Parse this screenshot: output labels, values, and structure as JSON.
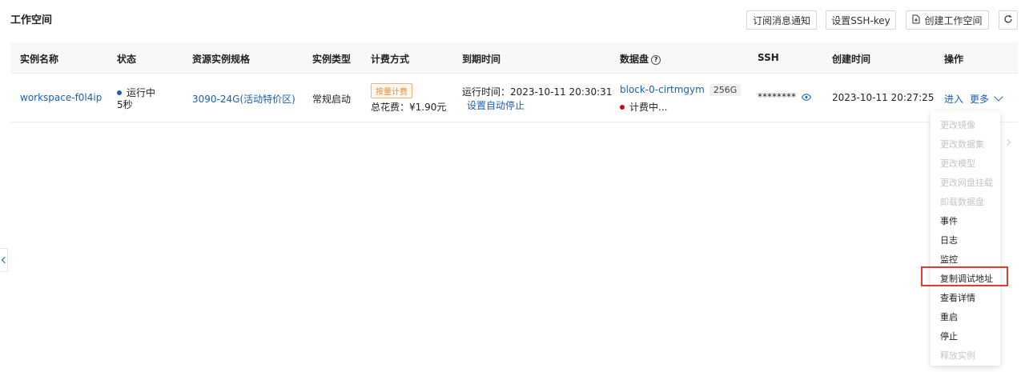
{
  "header": {
    "title": "工作空间",
    "subscribe_label": "订阅消息通知",
    "ssh_key_label": "设置SSH-key",
    "create_label": "创建工作空间"
  },
  "table": {
    "columns": [
      "实例名称",
      "状态",
      "资源实例规格",
      "实例类型",
      "计费方式",
      "到期时间",
      "数据盘",
      "SSH",
      "创建时间",
      "操作"
    ],
    "row": {
      "name": "workspace-f0l4ip",
      "status": "运行中",
      "status_duration": "5秒",
      "spec": "3090-24G(活动特价区)",
      "instance_type": "常规启动",
      "billing_tag": "按量计费",
      "total_cost": "总花费：¥1.90元",
      "expire_time": "运行时间：2023-10-11 20:30:31",
      "auto_stop": "设置自动停止",
      "disk_name": "block-0-cirtmgym",
      "disk_size": "256G",
      "disk_status": "计费中...",
      "ssh": "********",
      "created": "2023-10-11 20:27:25",
      "enter": "进入",
      "more": "更多"
    }
  },
  "dropdown": {
    "items": [
      {
        "label": "更改镜像",
        "enabled": false
      },
      {
        "label": "更改数据集",
        "enabled": false
      },
      {
        "label": "更改模型",
        "enabled": false
      },
      {
        "label": "更改网盘挂载",
        "enabled": false
      },
      {
        "label": "卸载数据盘",
        "enabled": false
      },
      {
        "label": "事件",
        "enabled": true
      },
      {
        "label": "日志",
        "enabled": true
      },
      {
        "label": "监控",
        "enabled": true
      },
      {
        "label": "复制调试地址",
        "enabled": true
      },
      {
        "label": "查看详情",
        "enabled": true
      },
      {
        "label": "重启",
        "enabled": true
      },
      {
        "label": "停止",
        "enabled": true
      },
      {
        "label": "释放实例",
        "enabled": false
      }
    ]
  },
  "colors": {
    "link": "#1a5fb4",
    "status_running": "#1a5fb4",
    "billing_dot": "#d0021b",
    "highlight": "#e03c31"
  }
}
